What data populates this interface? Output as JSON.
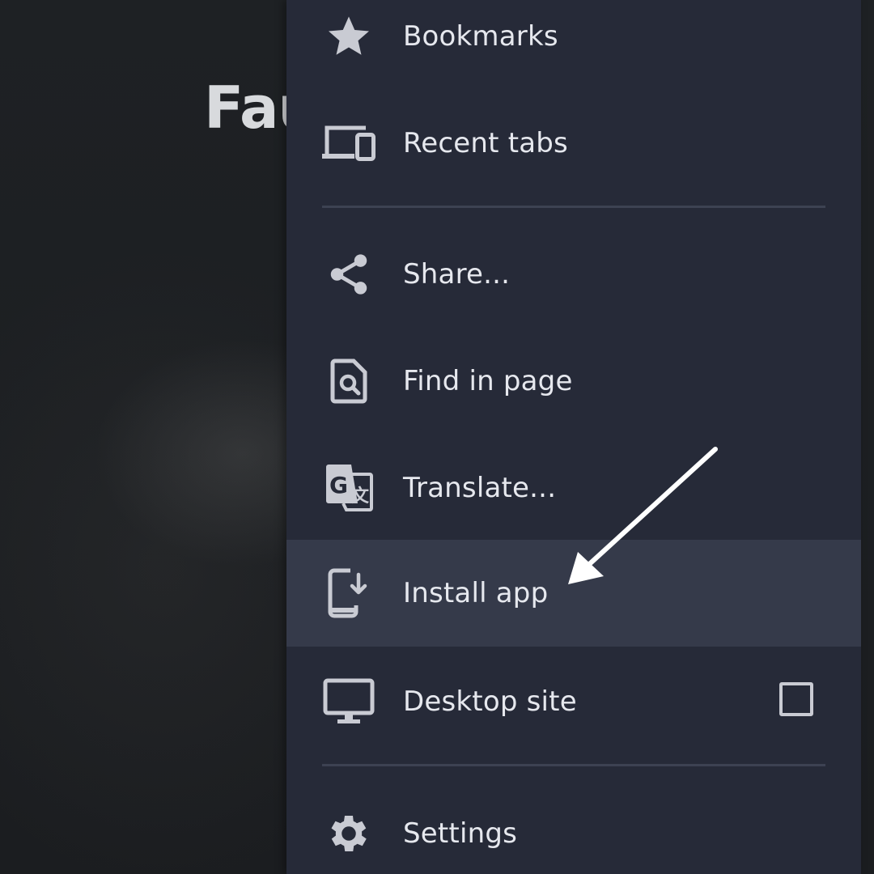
{
  "page": {
    "title_partial": "Fau"
  },
  "menu": {
    "items": [
      {
        "id": "bookmarks",
        "label": "Bookmarks",
        "icon": "star-icon"
      },
      {
        "id": "recent-tabs",
        "label": "Recent tabs",
        "icon": "devices-icon"
      },
      {
        "id": "share",
        "label": "Share...",
        "icon": "share-icon"
      },
      {
        "id": "find-in-page",
        "label": "Find in page",
        "icon": "find-in-page-icon"
      },
      {
        "id": "translate",
        "label": "Translate...",
        "icon": "translate-icon"
      },
      {
        "id": "install-app",
        "label": "Install app",
        "icon": "install-app-icon",
        "highlighted": true
      },
      {
        "id": "desktop-site",
        "label": "Desktop site",
        "icon": "desktop-icon",
        "checkbox": false
      },
      {
        "id": "settings",
        "label": "Settings",
        "icon": "gear-icon"
      }
    ]
  },
  "colors": {
    "menu_bg": "#262a38",
    "highlight_bg": "#353a4a",
    "text": "#e6e8ee",
    "icon": "#c9cbd3",
    "divider": "#3d4252",
    "annotation_arrow": "#ffffff"
  }
}
